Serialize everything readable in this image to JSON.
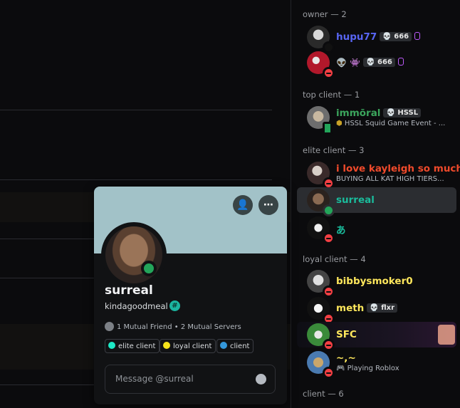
{
  "members": {
    "groups": [
      {
        "header": "owner — 2"
      },
      {
        "header": "top client — 1"
      },
      {
        "header": "elite client — 3"
      },
      {
        "header": "loyal client — 4"
      },
      {
        "header": "client — 6"
      }
    ],
    "hupu77": {
      "name": "hupu77",
      "tag": "666",
      "color": "#5865f2"
    },
    "owner2": {
      "emoji": "👽 👾",
      "tag": "666"
    },
    "immoral": {
      "name": "immōral",
      "tag": "HSSL",
      "activity": "HSSL Squid Game Event - ...",
      "color": "#3ba55c"
    },
    "kayleigh": {
      "name": "i love kayleigh so much",
      "activity": "BUYING ALL KAT HIGH TIERS...",
      "color": "#f04a2b"
    },
    "surreal": {
      "name": "surreal",
      "color": "#1abc9c"
    },
    "a_user": {
      "name": "あ",
      "color": "#1abc9c"
    },
    "bibby": {
      "name": "bibbysmoker0",
      "color": "#fee75c"
    },
    "meth": {
      "name": "meth",
      "tag": "flxr",
      "color": "#fee75c"
    },
    "sfc": {
      "name": "SFC",
      "color": "#fee75c"
    },
    "tilde": {
      "name": "~,~",
      "activity": "Playing Roblox",
      "color": "#fee75c"
    }
  },
  "profile": {
    "display_name": "surreal",
    "username": "kindagoodmeal",
    "badge": "#",
    "mutual_friends": "1 Mutual Friend",
    "mutual_servers": "2 Mutual Servers",
    "roles": [
      {
        "label": "elite client",
        "color": "#1de9c6"
      },
      {
        "label": "loyal client",
        "color": "#f5e31b"
      },
      {
        "label": "client",
        "color": "#3498db"
      }
    ],
    "message_placeholder": "Message @surreal"
  }
}
